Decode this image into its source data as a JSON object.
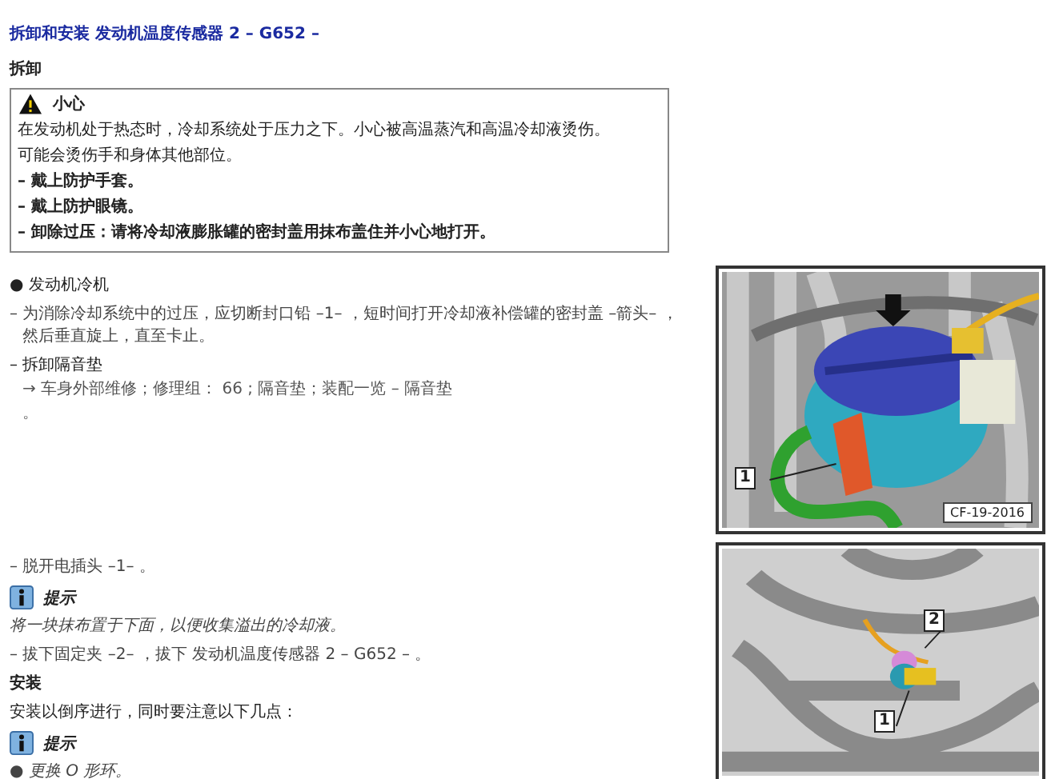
{
  "title": "拆卸和安装 发动机温度传感器 2 – G652 –",
  "subtitle": "拆卸",
  "caution": {
    "title": "小心",
    "lines": [
      {
        "kind": "text",
        "text": "在发动机处于热态时，冷却系统处于压力之下。小心被高温蒸汽和高温冷却液烫伤。"
      },
      {
        "kind": "text",
        "text": "可能会烫伤手和身体其他部位。"
      },
      {
        "kind": "dash",
        "text": "– 戴上防护手套。"
      },
      {
        "kind": "dash",
        "text": "– 戴上防护眼镜。"
      },
      {
        "kind": "dash",
        "text": "– 卸除过压：请将冷却液膨胀罐的密封盖用抹布盖住并小心地打开。"
      }
    ]
  },
  "sections": [
    {
      "items": [
        {
          "kind": "bullet",
          "text": "● 发动机冷机"
        },
        {
          "kind": "step",
          "text": "– 为消除冷却系统中的过压，应切断封口铅 –1– ，短时间打开冷却液补偿罐的密封盖 –箭头– ，然后垂直旋上，直至卡止。"
        },
        {
          "kind": "dash",
          "text": "– 拆卸隔音垫"
        },
        {
          "kind": "ref",
          "text": "→ 车身外部维修；修理组： 66 ; 隔音垫；装配一览 – 隔音垫"
        },
        {
          "kind": "ref",
          "text": "。"
        }
      ],
      "figure": {
        "kind": "reservoir",
        "callouts": [
          "1"
        ],
        "code": "CF-19-2016"
      }
    },
    {
      "items": [
        {
          "kind": "step",
          "text": "– 脱开电插头 –1– 。"
        },
        {
          "kind": "hint",
          "text": "提示"
        },
        {
          "kind": "note",
          "text": "将一块抹布置于下面，以便收集溢出的冷却液。"
        },
        {
          "kind": "step",
          "text": "– 拔下固定夹 –2– ，拔下 发动机温度传感器 2 – G652 – 。"
        },
        {
          "kind": "heading",
          "text": "安装"
        },
        {
          "kind": "para",
          "text": "安装以倒序进行，同时要注意以下几点："
        },
        {
          "kind": "hint",
          "text": "提示"
        },
        {
          "kind": "note",
          "text": "● 更换 O 形环。"
        }
      ],
      "figure": {
        "kind": "sensor",
        "callouts": [
          "1",
          "2"
        ]
      }
    }
  ]
}
